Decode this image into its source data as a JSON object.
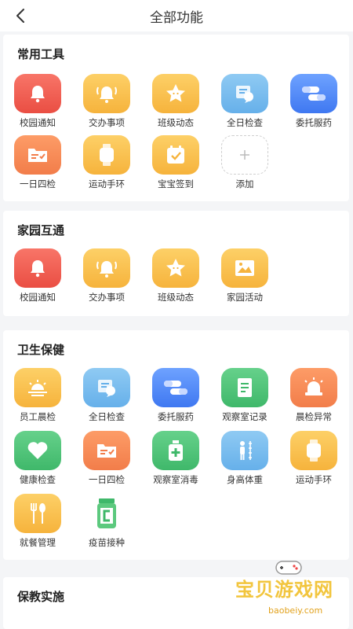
{
  "header": {
    "title": "全部功能"
  },
  "sections": [
    {
      "title": "常用工具",
      "items": [
        {
          "label": "校园通知",
          "icon": "bell-icon"
        },
        {
          "label": "交办事项",
          "icon": "bell-ring-icon"
        },
        {
          "label": "班级动态",
          "icon": "star-icon"
        },
        {
          "label": "全日检查",
          "icon": "chat-card-icon"
        },
        {
          "label": "委托服药",
          "icon": "pill-icon"
        },
        {
          "label": "一日四检",
          "icon": "folder-check-icon"
        },
        {
          "label": "运动手环",
          "icon": "smartwatch-icon"
        },
        {
          "label": "宝宝签到",
          "icon": "calendar-check-icon"
        },
        {
          "label": "添加",
          "icon": "plus-icon"
        }
      ]
    },
    {
      "title": "家园互通",
      "items": [
        {
          "label": "校园通知",
          "icon": "bell-icon"
        },
        {
          "label": "交办事项",
          "icon": "bell-ring-icon"
        },
        {
          "label": "班级动态",
          "icon": "star-icon"
        },
        {
          "label": "家园活动",
          "icon": "image-icon"
        }
      ]
    },
    {
      "title": "卫生保健",
      "items": [
        {
          "label": "员工晨检",
          "icon": "sunrise-icon"
        },
        {
          "label": "全日检查",
          "icon": "chat-card-icon"
        },
        {
          "label": "委托服药",
          "icon": "pill-icon"
        },
        {
          "label": "观察室记录",
          "icon": "document-icon"
        },
        {
          "label": "晨检异常",
          "icon": "alarm-light-icon"
        },
        {
          "label": "健康检查",
          "icon": "heart-icon"
        },
        {
          "label": "一日四检",
          "icon": "folder-check-icon"
        },
        {
          "label": "观察室消毒",
          "icon": "disinfect-icon"
        },
        {
          "label": "身高体重",
          "icon": "height-scale-icon"
        },
        {
          "label": "运动手环",
          "icon": "smartwatch-icon"
        },
        {
          "label": "就餐管理",
          "icon": "fork-spoon-icon"
        },
        {
          "label": "疫苗接种",
          "icon": "vaccine-icon"
        }
      ]
    },
    {
      "title": "保教实施",
      "items": []
    }
  ],
  "watermark": {
    "text": "宝贝游戏网",
    "url": "baobeiy.com"
  }
}
